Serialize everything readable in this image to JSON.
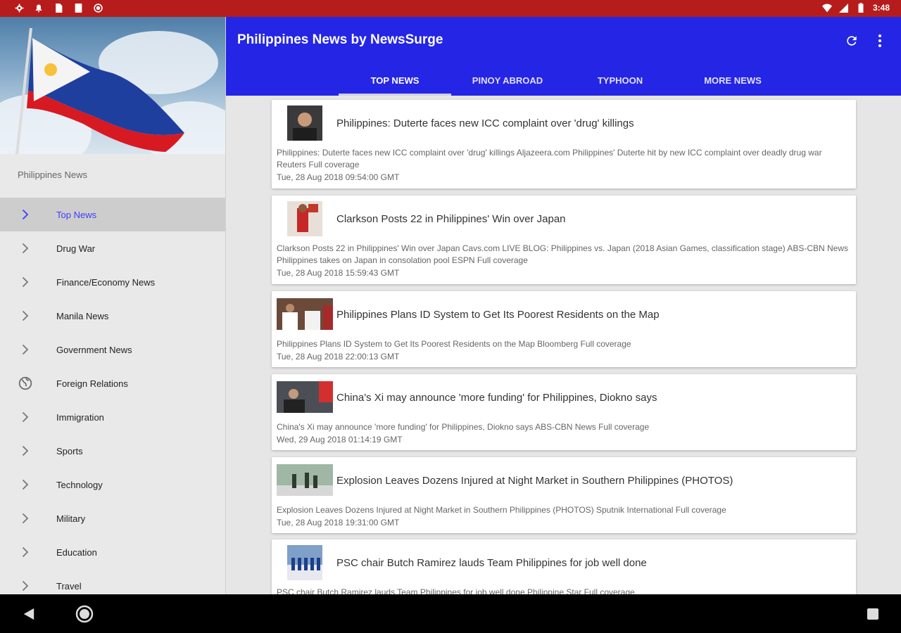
{
  "status_bar": {
    "time": "3:48"
  },
  "drawer": {
    "section_title": "Philippines News",
    "items": [
      {
        "label": "Top News",
        "icon": "chevron-right-icon",
        "active": true
      },
      {
        "label": "Drug War",
        "icon": "chevron-right-icon"
      },
      {
        "label": "Finance/Economy News",
        "icon": "chevron-right-icon"
      },
      {
        "label": "Manila News",
        "icon": "chevron-right-icon"
      },
      {
        "label": "Government News",
        "icon": "chevron-right-icon"
      },
      {
        "label": "Foreign Relations",
        "icon": "globe-icon"
      },
      {
        "label": "Immigration",
        "icon": "chevron-right-icon"
      },
      {
        "label": "Sports",
        "icon": "chevron-right-icon"
      },
      {
        "label": "Technology",
        "icon": "chevron-right-icon"
      },
      {
        "label": "Military",
        "icon": "chevron-right-icon"
      },
      {
        "label": "Education",
        "icon": "chevron-right-icon"
      },
      {
        "label": "Travel",
        "icon": "chevron-right-icon"
      }
    ]
  },
  "appbar": {
    "title": "Philippines News by NewsSurge",
    "tabs": [
      {
        "label": "TOP NEWS",
        "active": true
      },
      {
        "label": "PINOY ABROAD"
      },
      {
        "label": "TYPHOON"
      },
      {
        "label": "MORE NEWS"
      }
    ]
  },
  "colors": {
    "status_bar": "#b71c1c",
    "app_bar": "#2525e6",
    "active_nav": "#3d3dff"
  },
  "articles": [
    {
      "title": "Philippines: Duterte faces new ICC complaint over 'drug' killings",
      "description": "Philippines: Duterte faces new ICC complaint over 'drug' killings  Aljazeera.com  Philippines' Duterte hit by new ICC complaint over deadly drug war  Reuters  Full coverage",
      "date": "Tue, 28 Aug 2018 09:54:00 GMT"
    },
    {
      "title": "Clarkson Posts 22 in Philippines' Win over Japan",
      "description": "Clarkson Posts 22 in Philippines' Win over Japan  Cavs.com  LIVE BLOG: Philippines vs. Japan (2018 Asian Games, classification stage)  ABS-CBN News  Philippines takes on Japan in consolation pool  ESPN  Full coverage",
      "date": "Tue, 28 Aug 2018 15:59:43 GMT"
    },
    {
      "title": "Philippines Plans ID System to Get Its Poorest Residents on the Map",
      "description": "Philippines Plans ID System to Get Its Poorest Residents on the Map  Bloomberg  Full coverage",
      "date": "Tue, 28 Aug 2018 22:00:13 GMT"
    },
    {
      "title": "China's Xi may announce 'more funding' for Philippines, Diokno says",
      "description": "China's Xi may announce 'more funding' for Philippines, Diokno says  ABS-CBN News  Full coverage",
      "date": "Wed, 29 Aug 2018 01:14:19 GMT"
    },
    {
      "title": "Explosion Leaves Dozens Injured at Night Market in Southern Philippines (PHOTOS)",
      "description": "Explosion Leaves Dozens Injured at Night Market in Southern Philippines (PHOTOS)  Sputnik International  Full coverage",
      "date": "Tue, 28 Aug 2018 19:31:00 GMT"
    },
    {
      "title": "PSC chair Butch Ramirez lauds Team Philippines for job well done",
      "description": "PSC chair Butch Ramirez lauds Team Philippines for job well done  Philippine Star  Full coverage",
      "date": ""
    }
  ]
}
